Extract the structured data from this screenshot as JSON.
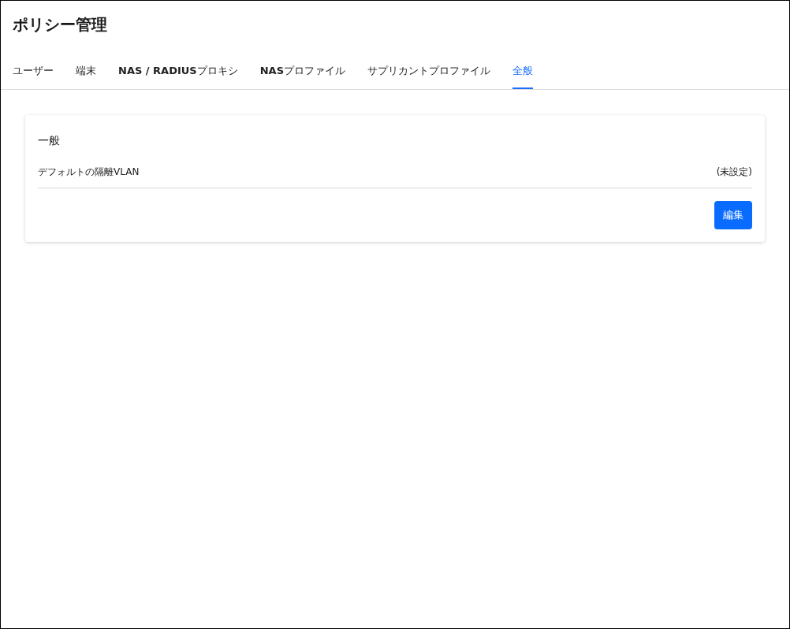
{
  "page_title": "ポリシー管理",
  "tabs": [
    {
      "label": "ユーザー",
      "selected": false
    },
    {
      "label": "端末",
      "selected": false
    },
    {
      "label": "**NAS / RADIUS**プロキシ",
      "selected": false
    },
    {
      "label": "**NAS**プロファイル",
      "selected": false
    },
    {
      "label": "サプリカントプロファイル",
      "selected": false
    },
    {
      "label": "全般",
      "selected": true
    }
  ],
  "card": {
    "title": "一般",
    "rows": [
      {
        "label": "デフォルトの隔離VLAN",
        "value": "(未設定)"
      }
    ],
    "button": "編集"
  }
}
